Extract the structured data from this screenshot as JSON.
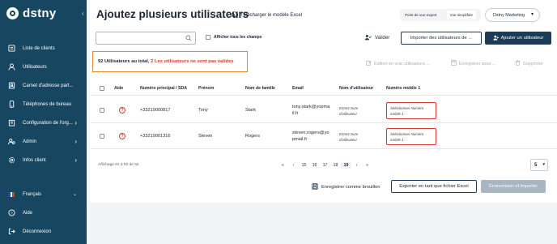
{
  "brand": {
    "logo_text": "dstny"
  },
  "sidebar": {
    "items": [
      {
        "label": "Liste de clients",
        "icon": "list-icon",
        "has_chevron": false
      },
      {
        "label": "Utilisateurs",
        "icon": "user-icon",
        "has_chevron": false
      },
      {
        "label": "Carnet d'adresse part...",
        "icon": "address-book-icon",
        "has_chevron": false
      },
      {
        "label": "Téléphones de bureau",
        "icon": "phone-icon",
        "has_chevron": false
      },
      {
        "label": "Configuration de l'org...",
        "icon": "building-icon",
        "has_chevron": true
      },
      {
        "label": "Admin",
        "icon": "admin-icon",
        "has_chevron": true
      },
      {
        "label": "Infos client",
        "icon": "gear-icon",
        "has_chevron": true
      }
    ],
    "language": "Français",
    "help": "Aide",
    "logout": "Déconnexion"
  },
  "header": {
    "title": "Ajoutez plusieurs utilisateurs",
    "download_link": "Télécharger le modèle Excel",
    "view_toggle": {
      "expert": "Point de vue expert",
      "simple": "Vue simplifiée"
    },
    "account": "Dstny Marketing"
  },
  "toolbar": {
    "search_placeholder": "",
    "show_all_fields": "Afficher tous les champs",
    "validate": "Valider",
    "import_users": "Importer des utilisateurs de ...",
    "add_user": "Ajouter un utilisateur"
  },
  "alert": {
    "total": "92 Utilisateurs au total,",
    "invalid": "2 Les utilisateurs ne sont pas valides"
  },
  "bulk_actions": {
    "bulk_edit": "Édition en vrac utilisateurs ...",
    "save_as": "Enregistrer sous ...",
    "delete": "Supprimer"
  },
  "table": {
    "columns": [
      "Aide",
      "Numéro principal / SDA",
      "Prénom",
      "Nom de famille",
      "Email",
      "Nom d'utilisateur",
      "Numéro mobile 1"
    ],
    "rows": [
      {
        "number": "+33219000817",
        "first_name": "Tony",
        "last_name": "Stark",
        "email_line1": "tony.stark@yopma",
        "email_line2": "il.fr",
        "username_line1": "Entrez Nom",
        "username_line2": "d'utilisateur",
        "mobile_line1": "Sélectionner Numéro",
        "mobile_line2": "mobile 1"
      },
      {
        "number": "+33219001316",
        "first_name": "Steven",
        "last_name": "Rogers",
        "email_line1": "steven.rogers@yo",
        "email_line2": "pmail.fr",
        "username_line1": "Entrez Nom",
        "username_line2": "d'utilisateur",
        "mobile_line1": "Sélectionner Numéro",
        "mobile_line2": "mobile 1"
      }
    ]
  },
  "pagination": {
    "info": "Affichage 91 à 92 de 92",
    "first": "«",
    "prev": "‹",
    "pages": [
      "15",
      "16",
      "17",
      "18",
      "19"
    ],
    "current": "19",
    "next": "›",
    "last": "»",
    "page_size": "5"
  },
  "footer": {
    "save_draft": "Enregistrer comme brouillon",
    "export_excel": "Exporter en tant que fichier Excel",
    "save_import": "Économiser et importer"
  },
  "colors": {
    "sidebar_bg": "#174760",
    "primary": "#1d3a58",
    "error": "#d43c2b",
    "alert_border": "#e4892b"
  }
}
